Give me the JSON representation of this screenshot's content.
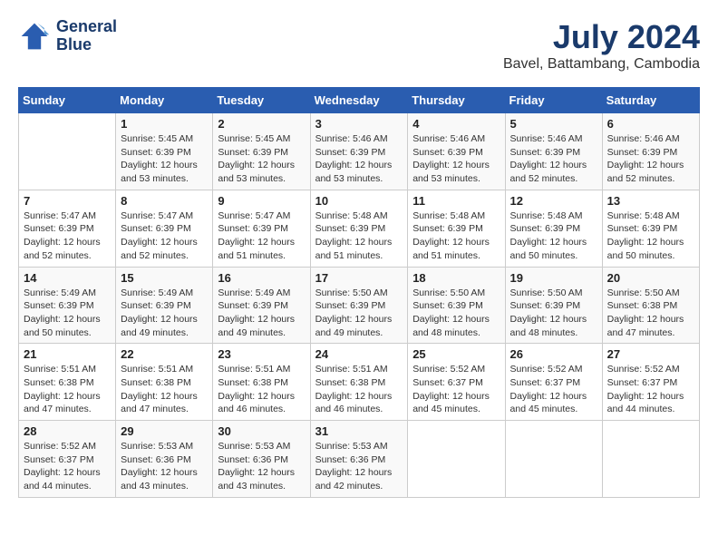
{
  "logo": {
    "line1": "General",
    "line2": "Blue"
  },
  "title": "July 2024",
  "location": "Bavel, Battambang, Cambodia",
  "days_header": [
    "Sunday",
    "Monday",
    "Tuesday",
    "Wednesday",
    "Thursday",
    "Friday",
    "Saturday"
  ],
  "weeks": [
    [
      {
        "day": "",
        "info": ""
      },
      {
        "day": "1",
        "info": "Sunrise: 5:45 AM\nSunset: 6:39 PM\nDaylight: 12 hours\nand 53 minutes."
      },
      {
        "day": "2",
        "info": "Sunrise: 5:45 AM\nSunset: 6:39 PM\nDaylight: 12 hours\nand 53 minutes."
      },
      {
        "day": "3",
        "info": "Sunrise: 5:46 AM\nSunset: 6:39 PM\nDaylight: 12 hours\nand 53 minutes."
      },
      {
        "day": "4",
        "info": "Sunrise: 5:46 AM\nSunset: 6:39 PM\nDaylight: 12 hours\nand 53 minutes."
      },
      {
        "day": "5",
        "info": "Sunrise: 5:46 AM\nSunset: 6:39 PM\nDaylight: 12 hours\nand 52 minutes."
      },
      {
        "day": "6",
        "info": "Sunrise: 5:46 AM\nSunset: 6:39 PM\nDaylight: 12 hours\nand 52 minutes."
      }
    ],
    [
      {
        "day": "7",
        "info": "Sunrise: 5:47 AM\nSunset: 6:39 PM\nDaylight: 12 hours\nand 52 minutes."
      },
      {
        "day": "8",
        "info": "Sunrise: 5:47 AM\nSunset: 6:39 PM\nDaylight: 12 hours\nand 52 minutes."
      },
      {
        "day": "9",
        "info": "Sunrise: 5:47 AM\nSunset: 6:39 PM\nDaylight: 12 hours\nand 51 minutes."
      },
      {
        "day": "10",
        "info": "Sunrise: 5:48 AM\nSunset: 6:39 PM\nDaylight: 12 hours\nand 51 minutes."
      },
      {
        "day": "11",
        "info": "Sunrise: 5:48 AM\nSunset: 6:39 PM\nDaylight: 12 hours\nand 51 minutes."
      },
      {
        "day": "12",
        "info": "Sunrise: 5:48 AM\nSunset: 6:39 PM\nDaylight: 12 hours\nand 50 minutes."
      },
      {
        "day": "13",
        "info": "Sunrise: 5:48 AM\nSunset: 6:39 PM\nDaylight: 12 hours\nand 50 minutes."
      }
    ],
    [
      {
        "day": "14",
        "info": "Sunrise: 5:49 AM\nSunset: 6:39 PM\nDaylight: 12 hours\nand 50 minutes."
      },
      {
        "day": "15",
        "info": "Sunrise: 5:49 AM\nSunset: 6:39 PM\nDaylight: 12 hours\nand 49 minutes."
      },
      {
        "day": "16",
        "info": "Sunrise: 5:49 AM\nSunset: 6:39 PM\nDaylight: 12 hours\nand 49 minutes."
      },
      {
        "day": "17",
        "info": "Sunrise: 5:50 AM\nSunset: 6:39 PM\nDaylight: 12 hours\nand 49 minutes."
      },
      {
        "day": "18",
        "info": "Sunrise: 5:50 AM\nSunset: 6:39 PM\nDaylight: 12 hours\nand 48 minutes."
      },
      {
        "day": "19",
        "info": "Sunrise: 5:50 AM\nSunset: 6:39 PM\nDaylight: 12 hours\nand 48 minutes."
      },
      {
        "day": "20",
        "info": "Sunrise: 5:50 AM\nSunset: 6:38 PM\nDaylight: 12 hours\nand 47 minutes."
      }
    ],
    [
      {
        "day": "21",
        "info": "Sunrise: 5:51 AM\nSunset: 6:38 PM\nDaylight: 12 hours\nand 47 minutes."
      },
      {
        "day": "22",
        "info": "Sunrise: 5:51 AM\nSunset: 6:38 PM\nDaylight: 12 hours\nand 47 minutes."
      },
      {
        "day": "23",
        "info": "Sunrise: 5:51 AM\nSunset: 6:38 PM\nDaylight: 12 hours\nand 46 minutes."
      },
      {
        "day": "24",
        "info": "Sunrise: 5:51 AM\nSunset: 6:38 PM\nDaylight: 12 hours\nand 46 minutes."
      },
      {
        "day": "25",
        "info": "Sunrise: 5:52 AM\nSunset: 6:37 PM\nDaylight: 12 hours\nand 45 minutes."
      },
      {
        "day": "26",
        "info": "Sunrise: 5:52 AM\nSunset: 6:37 PM\nDaylight: 12 hours\nand 45 minutes."
      },
      {
        "day": "27",
        "info": "Sunrise: 5:52 AM\nSunset: 6:37 PM\nDaylight: 12 hours\nand 44 minutes."
      }
    ],
    [
      {
        "day": "28",
        "info": "Sunrise: 5:52 AM\nSunset: 6:37 PM\nDaylight: 12 hours\nand 44 minutes."
      },
      {
        "day": "29",
        "info": "Sunrise: 5:53 AM\nSunset: 6:36 PM\nDaylight: 12 hours\nand 43 minutes."
      },
      {
        "day": "30",
        "info": "Sunrise: 5:53 AM\nSunset: 6:36 PM\nDaylight: 12 hours\nand 43 minutes."
      },
      {
        "day": "31",
        "info": "Sunrise: 5:53 AM\nSunset: 6:36 PM\nDaylight: 12 hours\nand 42 minutes."
      },
      {
        "day": "",
        "info": ""
      },
      {
        "day": "",
        "info": ""
      },
      {
        "day": "",
        "info": ""
      }
    ]
  ]
}
